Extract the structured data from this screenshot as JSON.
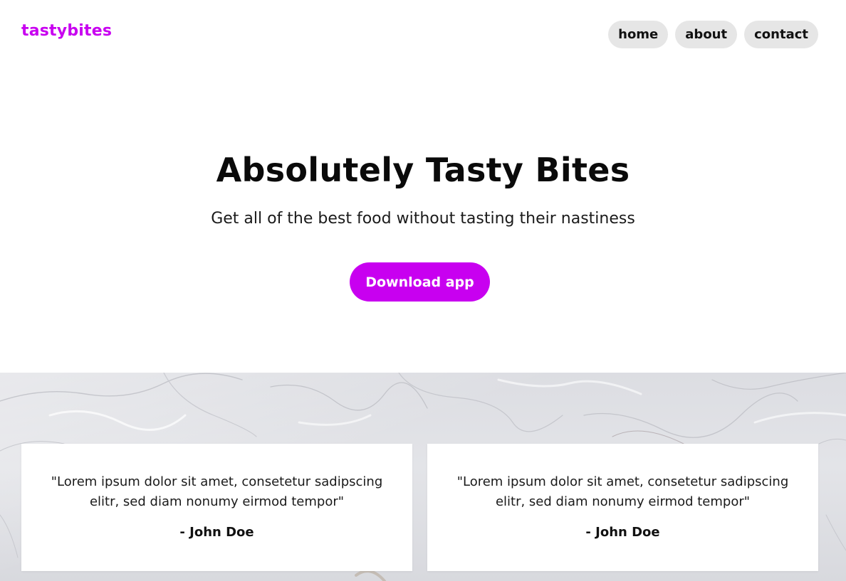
{
  "header": {
    "logo": "tastybites",
    "nav": [
      {
        "label": "home"
      },
      {
        "label": "about"
      },
      {
        "label": "contact"
      }
    ]
  },
  "hero": {
    "title": "Absolutely Tasty Bites",
    "subtitle": "Get all of the best food without tasting their nastiness",
    "cta_label": "Download app"
  },
  "testimonials": [
    {
      "quote": "\"Lorem ipsum dolor sit amet, consetetur sadipscing elitr, sed diam nonumy eirmod tempor\"",
      "author": "- John Doe"
    },
    {
      "quote": "\"Lorem ipsum dolor sit amet, consetetur sadipscing elitr, sed diam nonumy eirmod tempor\"",
      "author": "- John Doe"
    }
  ],
  "colors": {
    "accent": "#c800f0",
    "nav_pill": "#e6e6e6",
    "marble_bg": "#dcdde2"
  }
}
